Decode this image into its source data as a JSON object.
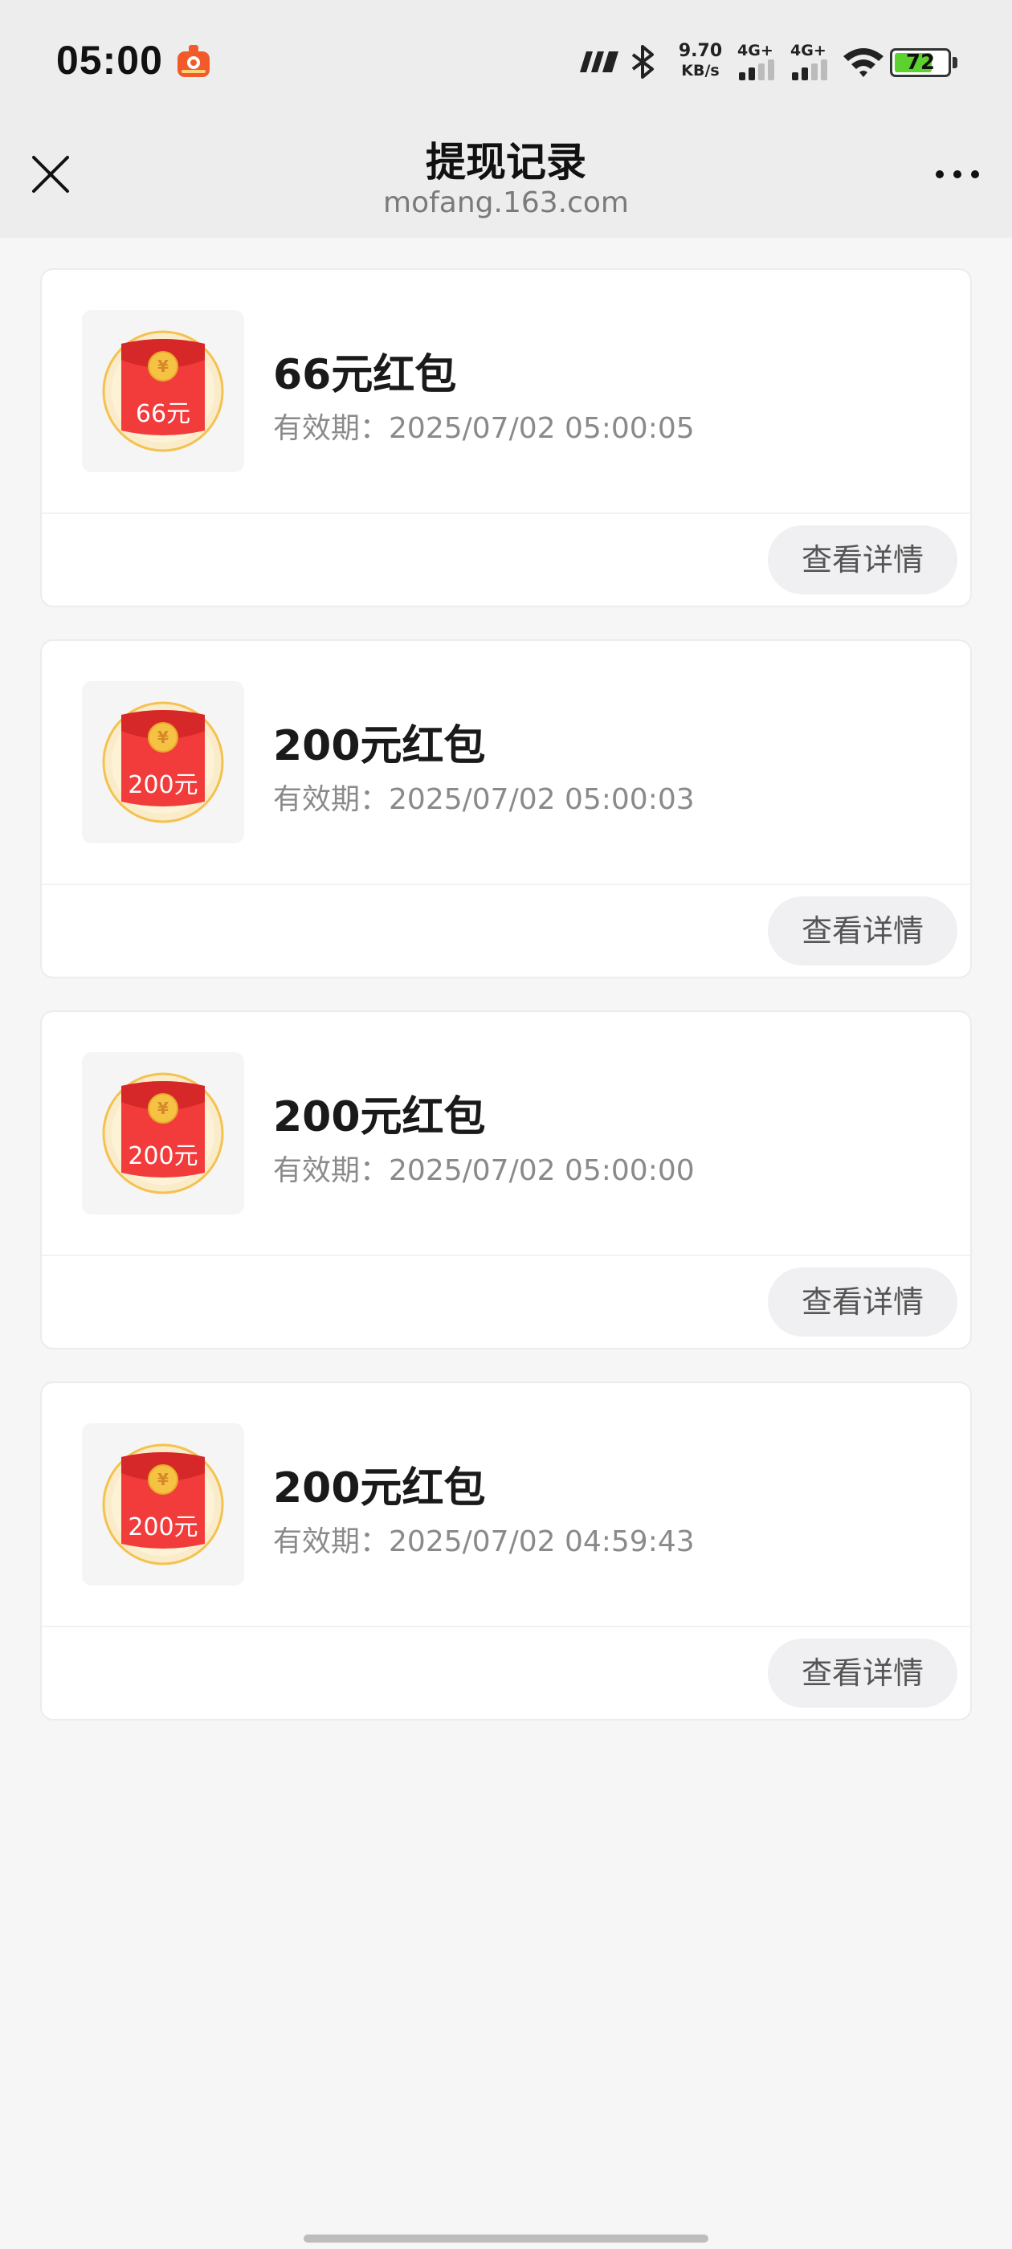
{
  "status_bar": {
    "time": "05:00",
    "app_icon": "red-app-notification-icon",
    "speed_value": "9.70",
    "speed_unit": "KB/s",
    "network1": "4G+",
    "network2": "4G+",
    "battery_level": 72,
    "battery_color": "#5bd22e",
    "icons": [
      "hd-signal-icon",
      "bluetooth-icon",
      "signal-bars-icon",
      "wifi-icon",
      "battery-icon"
    ]
  },
  "nav": {
    "title": "提现记录",
    "subtitle": "mofang.163.com",
    "close_icon": "close-icon",
    "more_icon": "more-icon"
  },
  "records": [
    {
      "title": "66元红包",
      "expiry_label": "有效期：",
      "expiry_value": "2025/07/02 05:00:05",
      "badge_amount": "66元",
      "button_label": "查看详情"
    },
    {
      "title": "200元红包",
      "expiry_label": "有效期：",
      "expiry_value": "2025/07/02 05:00:03",
      "badge_amount": "200元",
      "button_label": "查看详情"
    },
    {
      "title": "200元红包",
      "expiry_label": "有效期：",
      "expiry_value": "2025/07/02 05:00:00",
      "badge_amount": "200元",
      "button_label": "查看详情"
    },
    {
      "title": "200元红包",
      "expiry_label": "有效期：",
      "expiry_value": "2025/07/02 04:59:43",
      "badge_amount": "200元",
      "button_label": "查看详情"
    }
  ],
  "colors": {
    "envelope_red": "#f23b3b",
    "coin_gold": "#f6c244",
    "glow": "#fde4a8"
  }
}
